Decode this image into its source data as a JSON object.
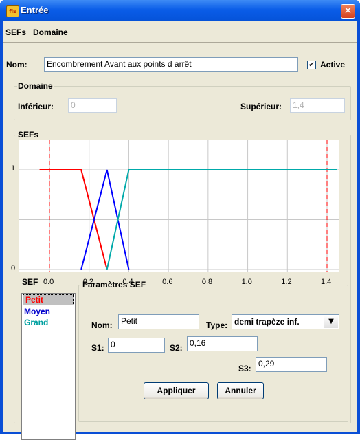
{
  "window": {
    "title": "Entrée",
    "icon": "fis-app-icon"
  },
  "menu": {
    "items": [
      "SEFs",
      "Domaine"
    ]
  },
  "name_row": {
    "label": "Nom:",
    "value": "Encombrement Avant aux points d arrêt",
    "active_label": "Active",
    "active_checked": true
  },
  "domain": {
    "title": "Domaine",
    "lower_label": "Inférieur:",
    "lower_value": "0",
    "upper_label": "Supérieur:",
    "upper_value": "1,4"
  },
  "sefs_panel": {
    "title": "SEFs"
  },
  "chart_data": {
    "type": "line",
    "xlim": [
      -0.05,
      1.45
    ],
    "ylim": [
      0,
      1
    ],
    "x_ticks": [
      "0.0",
      "0.2",
      "0.4",
      "0.6",
      "0.8",
      "1.0",
      "1.2",
      "1.4"
    ],
    "y_ticks": [
      "0",
      "1"
    ],
    "domain_markers": [
      0,
      1.4
    ],
    "grid": true,
    "series": [
      {
        "name": "Petit",
        "color": "#ff0000",
        "x": [
          -0.05,
          0.16,
          0.29
        ],
        "y": [
          1,
          1,
          0
        ]
      },
      {
        "name": "Moyen",
        "color": "#0000ff",
        "x": [
          0.16,
          0.29,
          0.4
        ],
        "y": [
          0,
          1,
          0
        ]
      },
      {
        "name": "Grand",
        "color": "#00aaaa",
        "x": [
          0.29,
          0.4,
          1.45
        ],
        "y": [
          0,
          1,
          1
        ]
      }
    ]
  },
  "sef_list": {
    "title": "SEF",
    "items": [
      {
        "label": "Petit",
        "color": "#ff0000",
        "selected": true
      },
      {
        "label": "Moyen",
        "color": "#0000cc",
        "selected": false
      },
      {
        "label": "Grand",
        "color": "#00a0a0",
        "selected": false
      }
    ]
  },
  "params": {
    "title": "Paramètres SEF",
    "name_label": "Nom:",
    "name_value": "Petit",
    "type_label": "Type:",
    "type_value": "demi trapèze inf.",
    "s1_label": "S1:",
    "s1_value": "0",
    "s2_label": "S2:",
    "s2_value": "0,16",
    "s3_label": "S3:",
    "s3_value": "0,29",
    "apply_label": "Appliquer",
    "cancel_label": "Annuler"
  }
}
